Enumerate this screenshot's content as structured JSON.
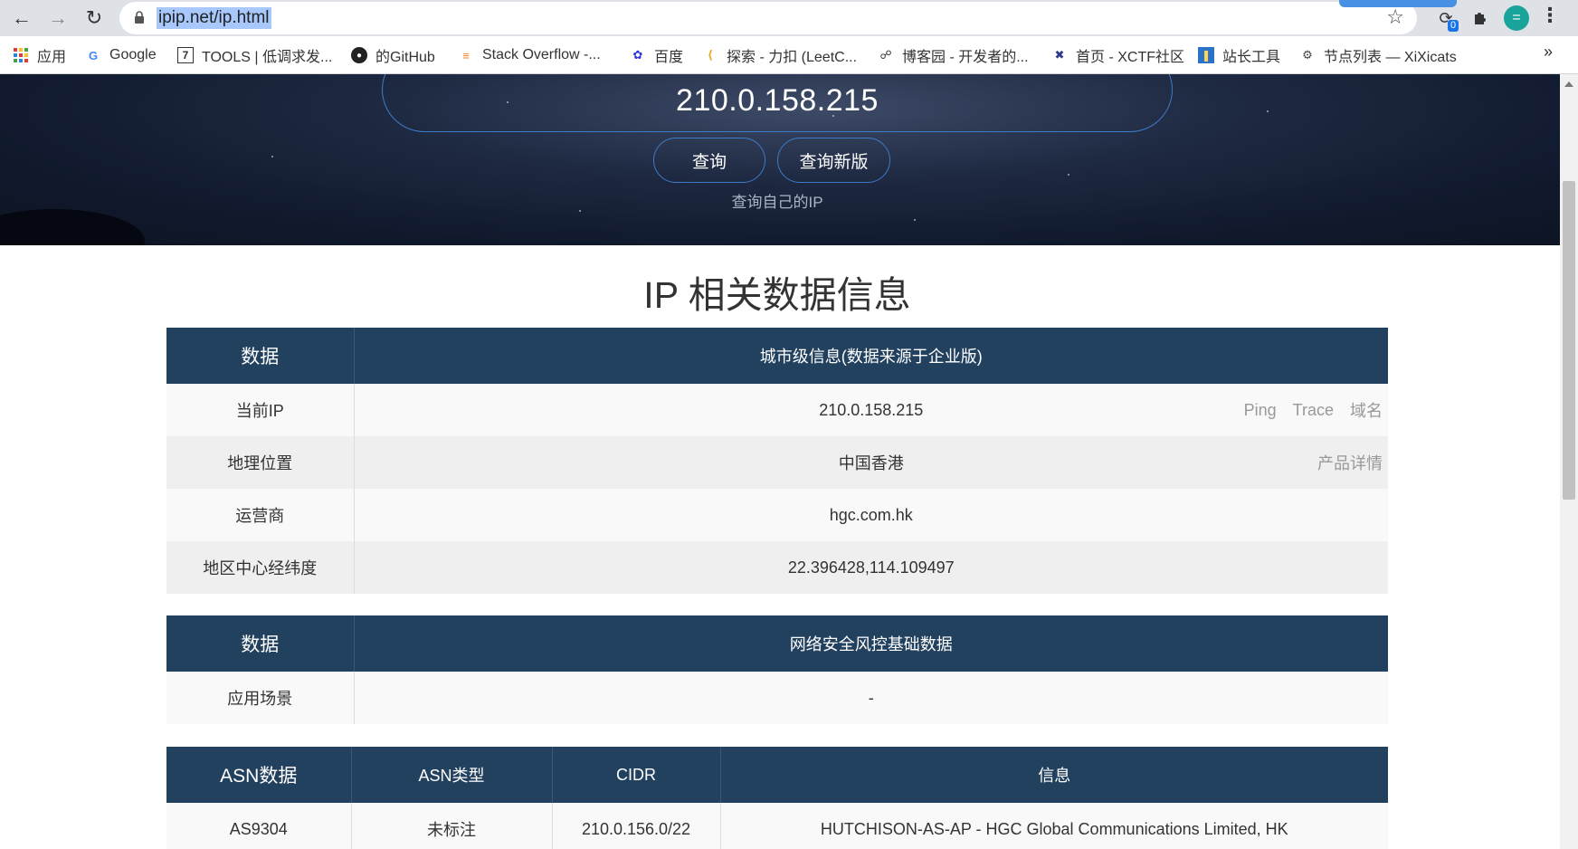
{
  "browser": {
    "url": "ipip.net/ip.html",
    "extension_badge": "0",
    "avatar_letter": "="
  },
  "bookmarks": [
    {
      "label": "应用",
      "icon": "apps-grid-icon"
    },
    {
      "label": "Google",
      "icon": "google-icon"
    },
    {
      "label": "TOOLS | 低调求发...",
      "icon": "tools-icon"
    },
    {
      "label": "的GitHub",
      "icon": "github-icon"
    },
    {
      "label": "Stack Overflow -...",
      "icon": "stackoverflow-icon"
    },
    {
      "label": "百度",
      "icon": "baidu-icon"
    },
    {
      "label": "探索 - 力扣 (LeetC...",
      "icon": "leetcode-icon"
    },
    {
      "label": "博客园 - 开发者的...",
      "icon": "cnblogs-icon"
    },
    {
      "label": "首页 - XCTF社区",
      "icon": "xctf-icon"
    },
    {
      "label": "站长工具",
      "icon": "chinaz-icon"
    },
    {
      "label": "节点列表 — XiXicats",
      "icon": "xixicats-icon"
    }
  ],
  "hero": {
    "ip": "210.0.158.215",
    "query_button": "查询",
    "query_new_button": "查询新版",
    "self_link": "查询自己的IP"
  },
  "section_title": "IP 相关数据信息",
  "city_table": {
    "headers": [
      "数据",
      "城市级信息(数据来源于企业版)"
    ],
    "rows": [
      {
        "label": "当前IP",
        "value": "210.0.158.215"
      },
      {
        "label": "地理位置",
        "value": "中国香港"
      },
      {
        "label": "运营商",
        "value": "hgc.com.hk"
      },
      {
        "label": "地区中心经纬度",
        "value": "22.396428,114.109497"
      }
    ],
    "links": {
      "ping": "Ping",
      "trace": "Trace",
      "domain": "域名",
      "product": "产品详情"
    }
  },
  "risk_table": {
    "headers": [
      "数据",
      "网络安全风控基础数据"
    ],
    "rows": [
      {
        "label": "应用场景",
        "value": "-"
      }
    ]
  },
  "asn_table": {
    "headers": [
      "ASN数据",
      "ASN类型",
      "CIDR",
      "信息"
    ],
    "rows": [
      {
        "asn": "AS9304",
        "type": "未标注",
        "cidr": "210.0.156.0/22",
        "info": "HUTCHISON-AS-AP - HGC Global Communications Limited, HK"
      }
    ]
  }
}
